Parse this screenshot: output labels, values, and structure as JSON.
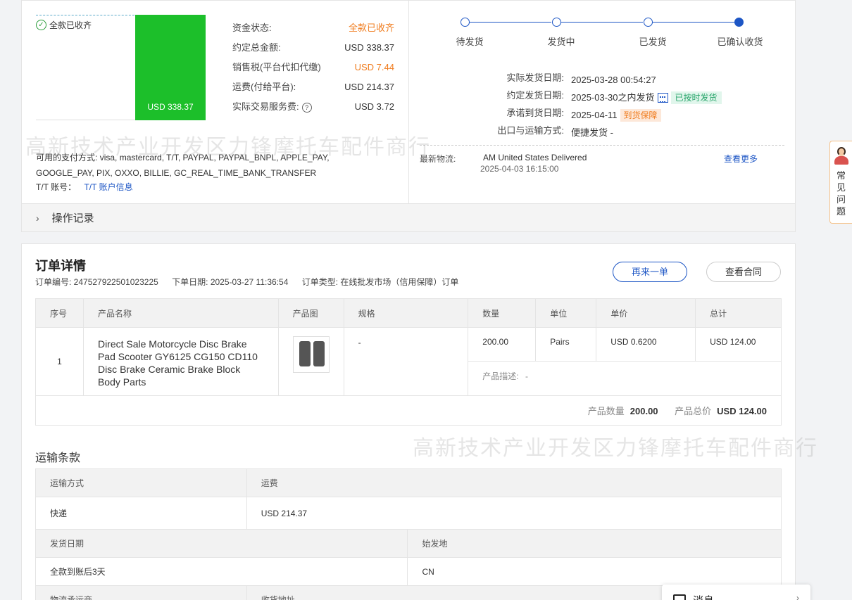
{
  "payment": {
    "status_badge": "全款已收齐",
    "bar_amount": "USD 338.37",
    "rows": [
      {
        "label": "资金状态:",
        "value": "全款已收齐",
        "color": "orange"
      },
      {
        "label": "约定总金额:",
        "value": "USD 338.37",
        "color": ""
      },
      {
        "label": "销售税(平台代扣代缴)",
        "value": "USD 7.44",
        "color": "orange"
      },
      {
        "label": "运费(付给平台):",
        "value": "USD 214.37",
        "color": ""
      },
      {
        "label": "实际交易服务费:",
        "value": "USD 3.72",
        "color": ""
      }
    ],
    "methods_label": "可用的支付方式:",
    "methods_value": "visa, mastercard, T/T, PAYPAL, PAYPAL_BNPL, APPLE_PAY, GOOGLE_PAY, PIX, OXXO, BILLIE, GC_REAL_TIME_BANK_TRANSFER",
    "tt_label": "T/T 账号：",
    "tt_link": "T/T 账户信息"
  },
  "steps": [
    "待发货",
    "发货中",
    "已发货",
    "已确认收货"
  ],
  "shipping_info": {
    "actual_date_label": "实际发货日期:",
    "actual_date": "2025-03-28 00:54:27",
    "agreed_date_label": "约定发货日期:",
    "agreed_date": "2025-03-30之内发货",
    "ontime_tag": "已按时发货",
    "promise_label": "承诺到货日期:",
    "promise_date": "2025-04-11",
    "promise_tag": "到货保障",
    "method_label": "出口与运输方式:",
    "method_value": "便捷发货 -"
  },
  "logistics": {
    "label": "最新物流:",
    "location": "AM United States  Delivered",
    "datetime": "2025-04-03 16:15:00",
    "more": "查看更多"
  },
  "ops_label": "操作记录",
  "order": {
    "title": "订单详情",
    "number": "订单编号: 247527922501023225",
    "date": "下单日期: 2025-03-27 11:36:54",
    "type": "订单类型: 在线批发市场（信用保障）订单",
    "reorder_btn": "再来一单",
    "contract_btn": "查看合同",
    "headers": [
      "序号",
      "产品名称",
      "产品图",
      "规格",
      "数量",
      "单位",
      "单价",
      "总计"
    ],
    "item": {
      "index": "1",
      "name": "Direct Sale Motorcycle Disc Brake Pad Scooter GY6125 CG150 CD110 Disc Brake Ceramic Brake Block Body Parts",
      "spec": "-",
      "qty": "200.00",
      "unit": "Pairs",
      "price": "USD 0.6200",
      "total": "USD 124.00",
      "desc_label": "产品描述:",
      "desc_value": "-"
    },
    "sum_qty_label": "产品数量",
    "sum_qty": "200.00",
    "sum_total_label": "产品总价",
    "sum_total": "USD 124.00"
  },
  "ship_terms": {
    "title": "运输条款",
    "method_label": "运输方式",
    "fee_label": "运费",
    "method_value": "快递",
    "fee_value": "USD 214.37",
    "date_label": "发货日期",
    "origin_label": "始发地",
    "date_value": "全款到账后3天",
    "origin_value": "CN",
    "carrier_label": "物流承运商",
    "address_label": "收货地址"
  },
  "faq_label": "常见问题",
  "message_label": "消息",
  "watermark": "高新技术产业开发区力锋摩托车配件商行"
}
